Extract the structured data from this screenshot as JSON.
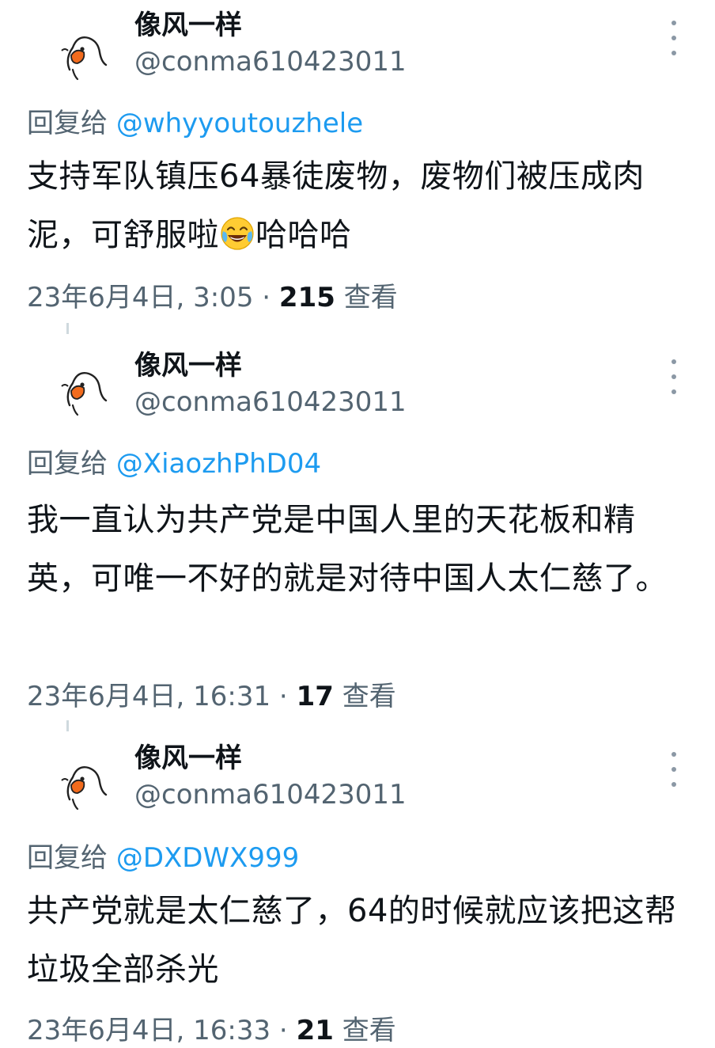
{
  "tweets": [
    {
      "display_name": "像风一样",
      "handle": "@conma610423011",
      "reply_label": "回复给",
      "reply_to": "@whyyoutouzhele",
      "text_before_emoji": "支持军队镇压64暴徒废物，废物们被压成肉泥，可舒服啦",
      "emoji": "face-with-tears-of-joy",
      "text_after_emoji": "哈哈哈",
      "timestamp": "23年6月4日, 3:05 · ",
      "views_count": "215",
      "views_label": " 查看"
    },
    {
      "display_name": "像风一样",
      "handle": "@conma610423011",
      "reply_label": "回复给",
      "reply_to": "@XiaozhPhD04",
      "text": "我一直认为共产党是中国人里的天花板和精英，可唯一不好的就是对待中国人太仁慈了。",
      "timestamp": "23年6月4日, 16:31 · ",
      "views_count": "17",
      "views_label": " 查看"
    },
    {
      "display_name": "像风一样",
      "handle": "@conma610423011",
      "reply_label": "回复给",
      "reply_to": "@DXDWX999",
      "text": "共产党就是太仁慈了，64的时候就应该把这帮垃圾全部杀光",
      "timestamp": "23年6月4日, 16:33 · ",
      "views_count": "21",
      "views_label": " 查看"
    }
  ],
  "colors": {
    "text": "#0f1419",
    "secondary": "#536471",
    "link": "#1d9bf0",
    "avatar_accent": "#f26b1d"
  },
  "icons": {
    "avatar": "cartoon-duck-avatar",
    "more": "more-vertical-icon"
  }
}
